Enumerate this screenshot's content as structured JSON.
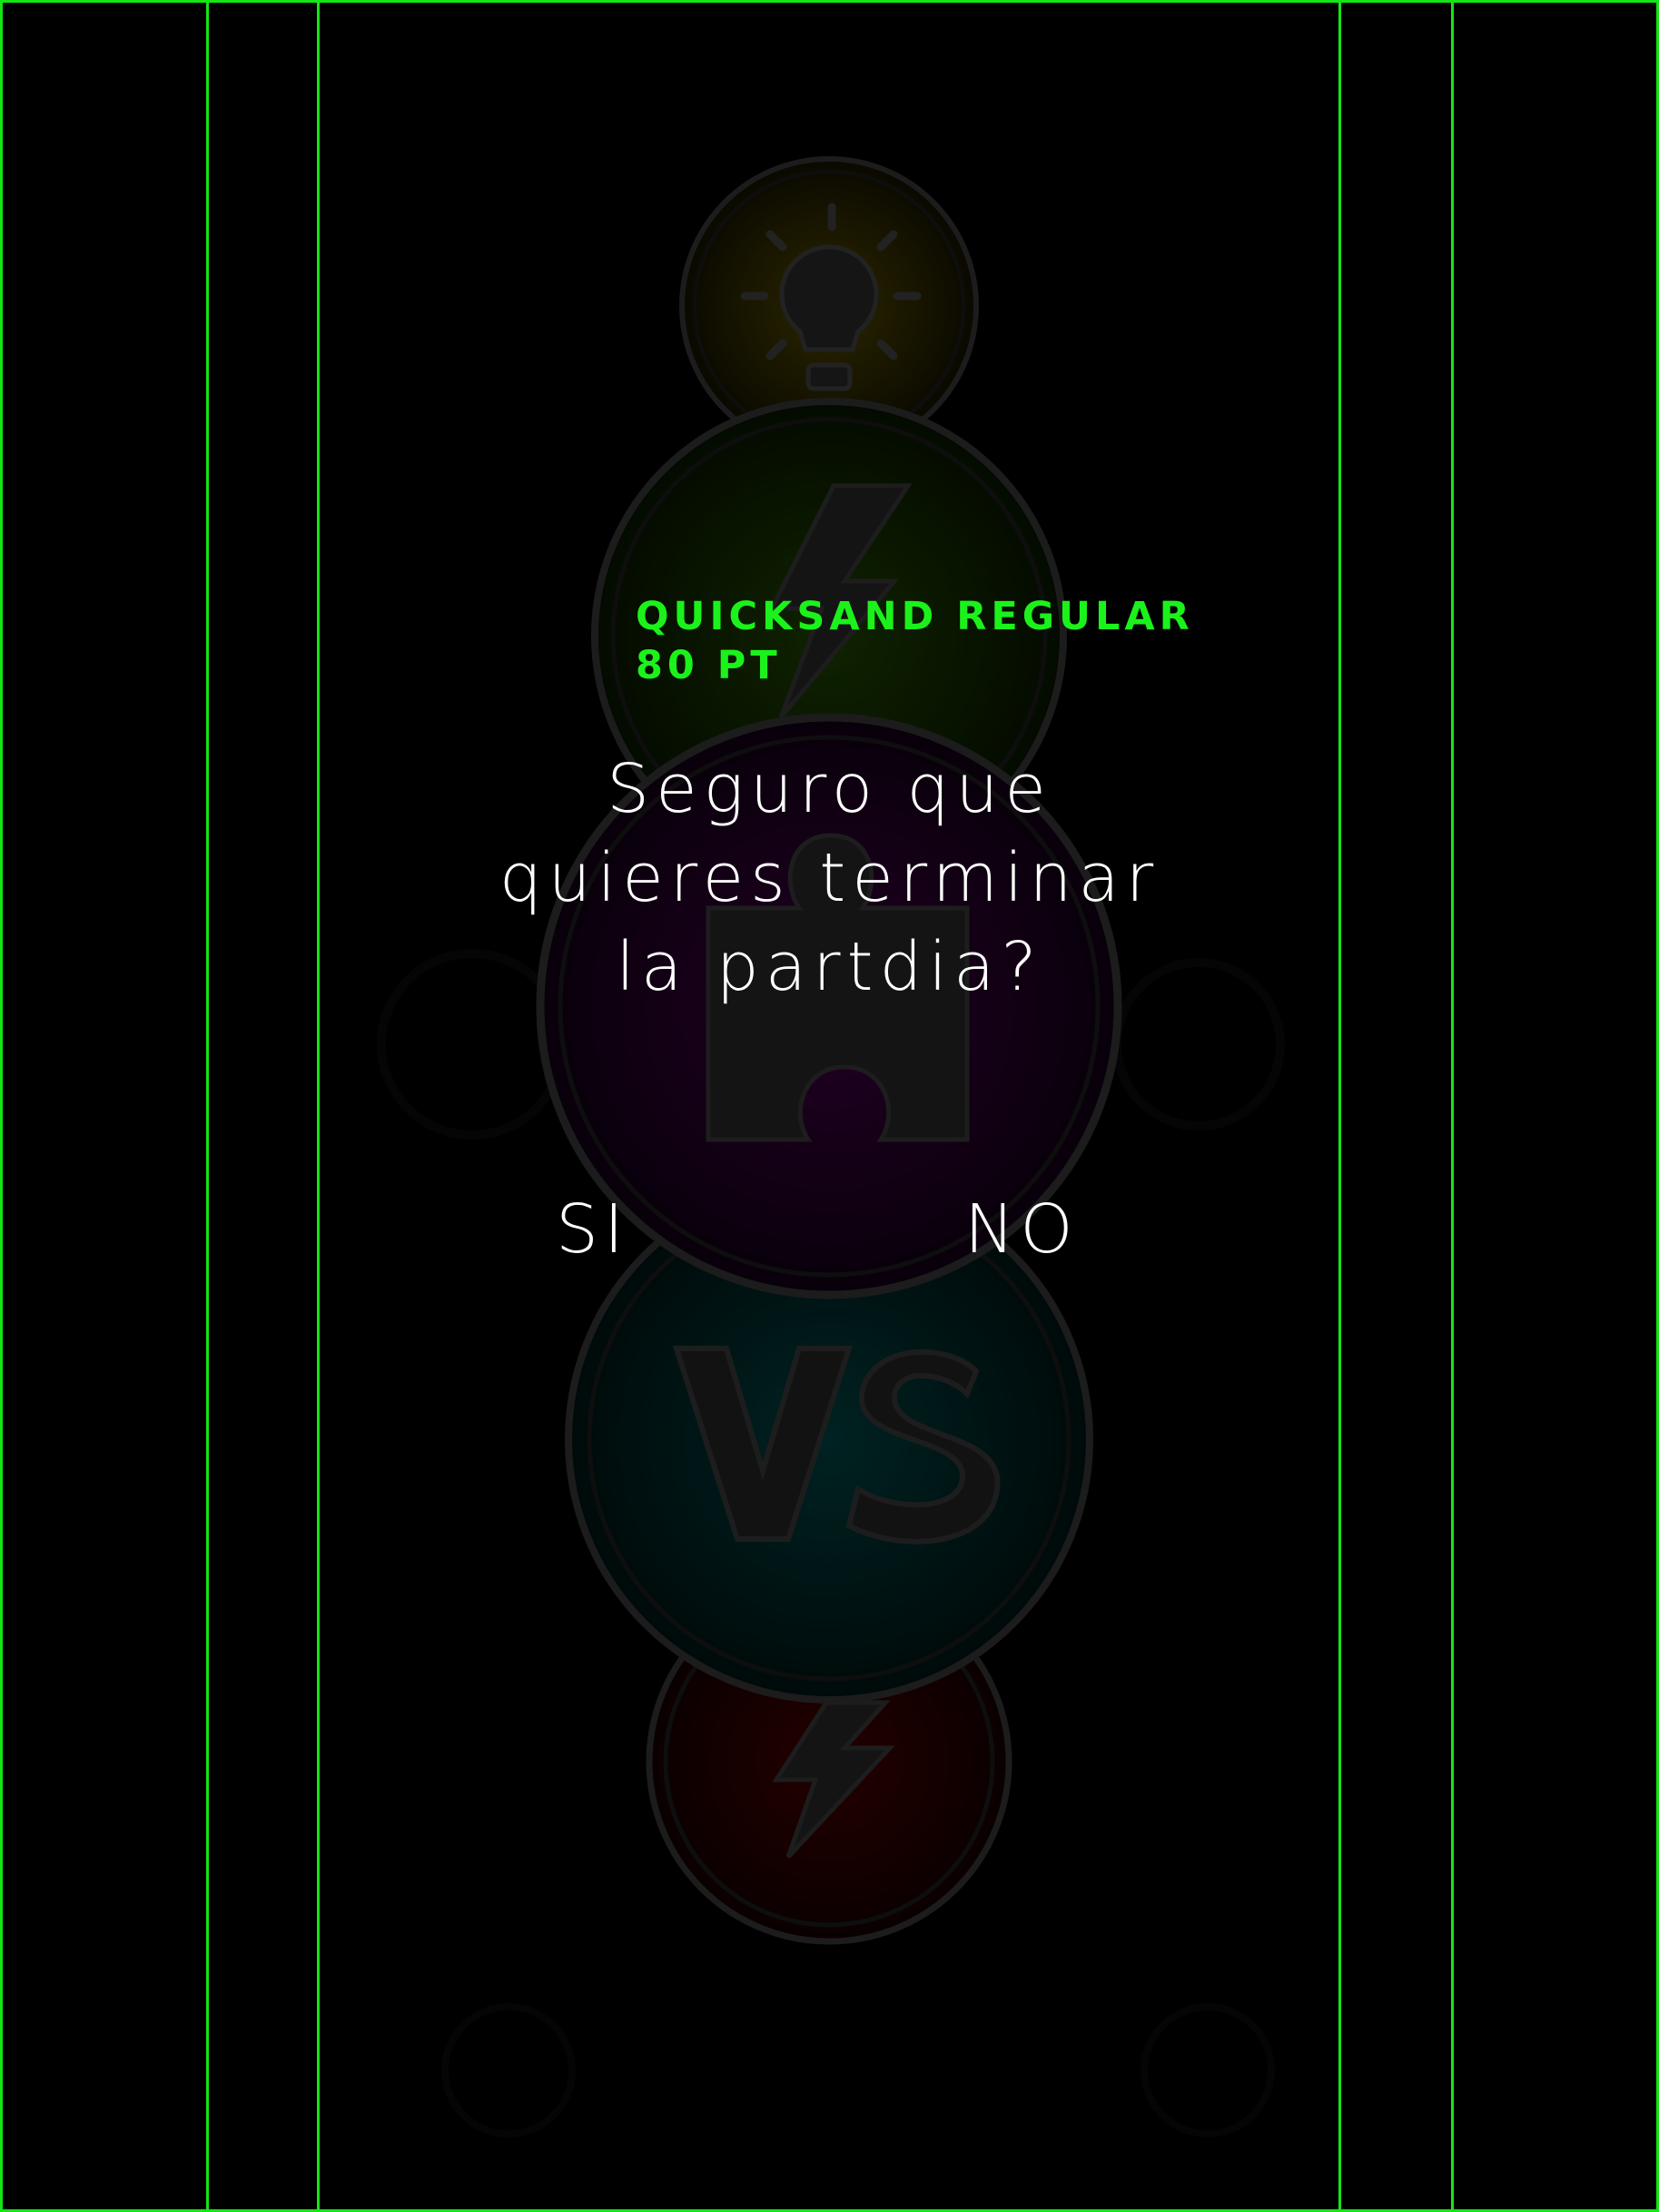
{
  "spec_note": {
    "line1": "QUICKSAND REGULAR",
    "line2": "80 PT"
  },
  "dialog": {
    "lines": [
      "Seguro que",
      "quieres terminar",
      "la partdia?"
    ],
    "confirm_label": "SI",
    "cancel_label": "NO"
  },
  "background_icons": [
    {
      "icon": "lightbulb-icon",
      "tint": "#2a2600"
    },
    {
      "icon": "lightning-icon",
      "tint": "#0c1f00"
    },
    {
      "icon": "puzzle-icon",
      "tint": "#1e0020"
    },
    {
      "icon": "versus-icon",
      "tint": "#001d1d"
    },
    {
      "icon": "lightning-small-icon",
      "tint": "#210000"
    }
  ],
  "colors": {
    "background": "#000000",
    "guide": "#14e614",
    "spec_text": "#1bf21b",
    "dialog_text": "#ffffff",
    "icon_outline": "#1c1c1c"
  }
}
